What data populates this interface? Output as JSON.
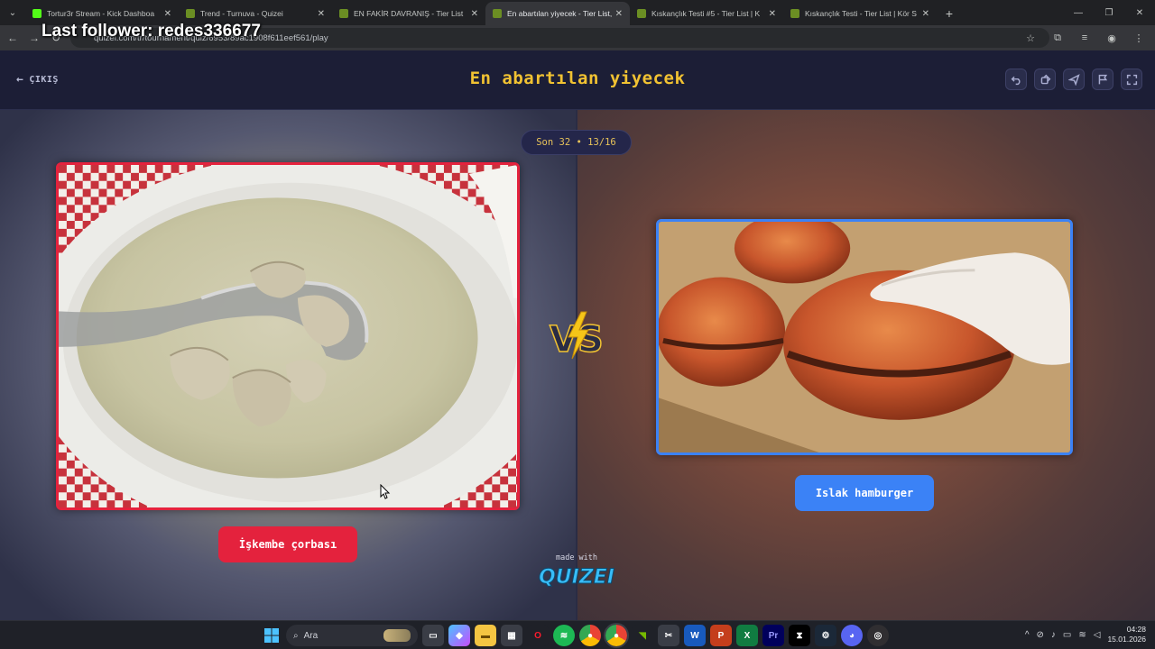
{
  "browser": {
    "tabs": [
      {
        "title": "Tortur3r Stream - Kick Dashboa",
        "fav_color": "#53fc18",
        "active": false
      },
      {
        "title": "Trend - Turnuva - Quizei",
        "fav_color": "#6b8e23",
        "active": false
      },
      {
        "title": "EN FAKİR DAVRANIŞ - Tier List",
        "fav_color": "#6b8e23",
        "active": false
      },
      {
        "title": "En abartılan yiyecek - Tier List, ",
        "fav_color": "#6b8e23",
        "active": true
      },
      {
        "title": "Kıskançlık Testi #5 - Tier List | K",
        "fav_color": "#6b8e23",
        "active": false
      },
      {
        "title": "Kıskançlık Testi - Tier List | Kör S",
        "fav_color": "#6b8e23",
        "active": false
      }
    ],
    "url": "quizei.com/tr/tournament/quiz/6953/89ac1908f611eef561/play",
    "follower_overlay": "Last follower: redes336677"
  },
  "app": {
    "exit_label": "ÇIKIŞ",
    "title": "En abartılan yiyecek",
    "round": "Son 32 • 13/16",
    "left_choice": "İşkembe çorbası",
    "right_choice": "Islak hamburger",
    "made_with": "made with",
    "brand": "QUIZEI",
    "accent_left": "#e4223d",
    "accent_right": "#3b82f6",
    "title_color": "#f1c232"
  },
  "taskbar": {
    "search_placeholder": "Ara",
    "time": "04:28",
    "date": "15.01.2026"
  }
}
